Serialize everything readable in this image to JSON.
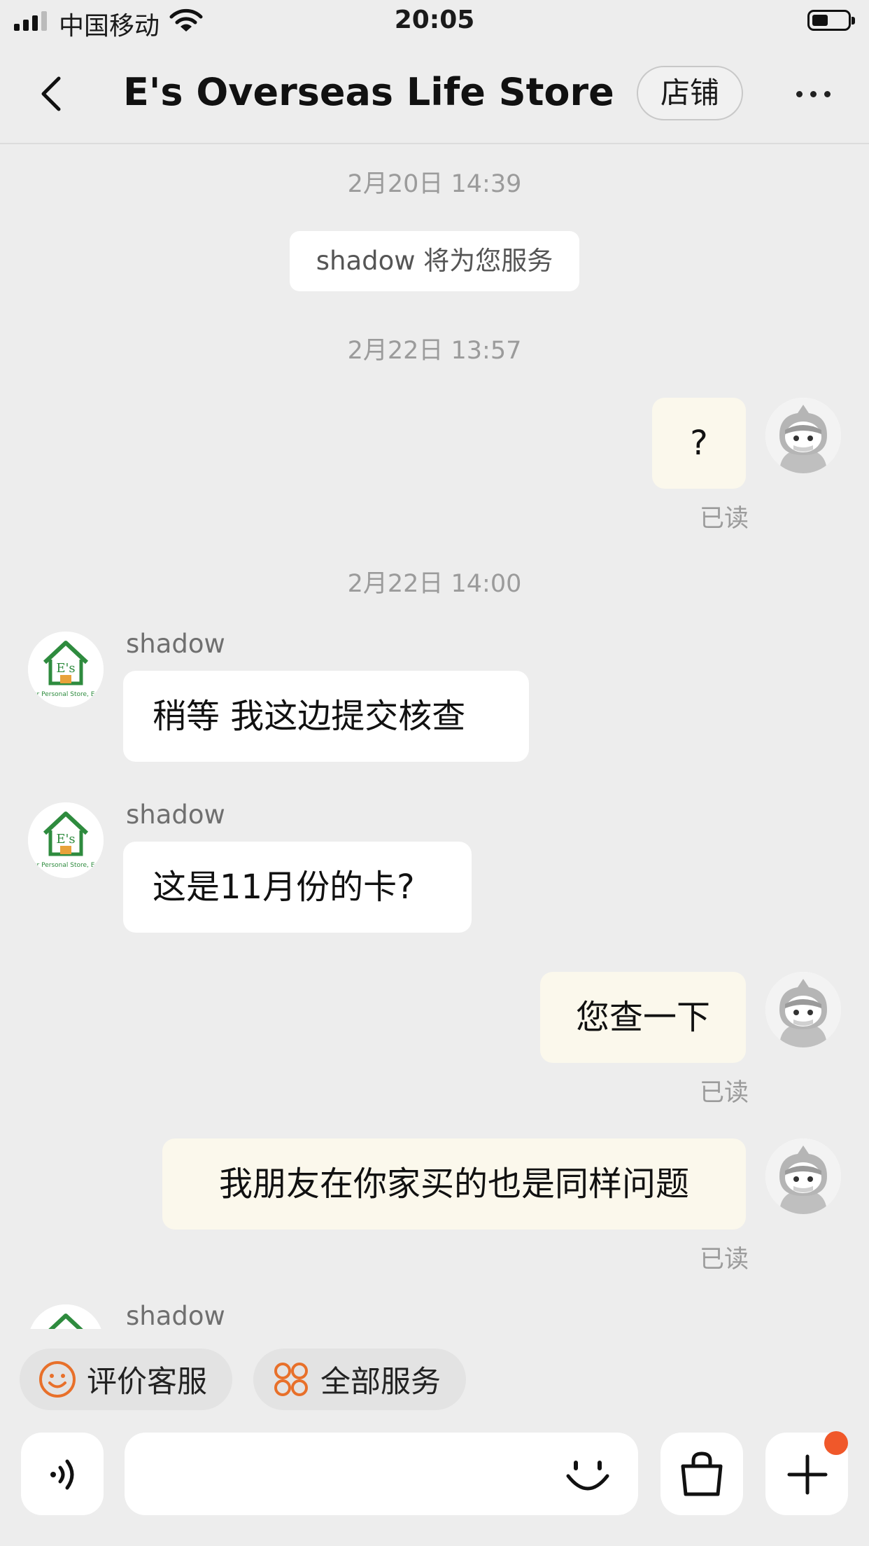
{
  "status_bar": {
    "carrier": "中国移动",
    "time": "20:05"
  },
  "header": {
    "title": "E's Overseas Life Store",
    "shop_button": "店铺"
  },
  "messages": {
    "ts1": "2月20日 14:39",
    "system": "shadow 将为您服务",
    "ts2": "2月22日 13:57",
    "out1": "?",
    "read1": "已读",
    "ts3": "2月22日 14:00",
    "in1_name": "shadow",
    "in1_text": "稍等 我这边提交核查",
    "in2_name": "shadow",
    "in2_text": "这是11月份的卡?",
    "out2": "您查一下",
    "read2": "已读",
    "out3": "我朋友在你家买的也是同样问题",
    "read3": "已读",
    "in3_name": "shadow",
    "store_avatar_logo": "E's",
    "store_avatar_tagline": "Your Personal Store, Easy"
  },
  "quick_actions": {
    "rate": "评价客服",
    "all_services": "全部服务"
  },
  "input_bar": {
    "placeholder": ""
  },
  "colors": {
    "accent": "#f0582a",
    "icon_orange": "#e8702a",
    "bubble_out": "#fbf8ec",
    "background": "#ededed",
    "logo_green": "#2e8b3e"
  }
}
